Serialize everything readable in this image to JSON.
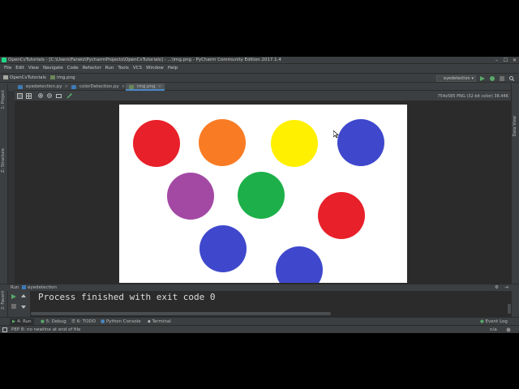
{
  "window": {
    "title": "OpenCvTutorials - [C:\\Users\\Farwiz\\PycharmProjects\\OpenCvTutorials] - ...\\img.png - PyCharm Community Edition 2017.1.4",
    "controls": [
      "–",
      "☐",
      "✕"
    ]
  },
  "menu": [
    "File",
    "Edit",
    "View",
    "Navigate",
    "Code",
    "Refactor",
    "Run",
    "Tools",
    "VCS",
    "Window",
    "Help"
  ],
  "breadcrumb": {
    "project": "OpenCvTutorials",
    "file": "img.png"
  },
  "run_config": {
    "label": "eyedetection"
  },
  "tabs": [
    {
      "label": "eyedetection.py",
      "close": "×"
    },
    {
      "label": "colorDetection.py",
      "close": "×"
    },
    {
      "label": "img.png",
      "close": "×",
      "active": true
    }
  ],
  "side_labels": {
    "project": "1: Project",
    "structure": "Z: Structure",
    "favorites": "2: Favorites",
    "database": "Data View"
  },
  "image_viewer": {
    "info": "754x585 PNG (32-bit color) 38.44K",
    "circles": [
      {
        "color": "#e8202a"
      },
      {
        "color": "#f97c25"
      },
      {
        "color": "#fff000"
      },
      {
        "color": "#3f48cc"
      },
      {
        "color": "#a349a4"
      },
      {
        "color": "#1db04a"
      },
      {
        "color": "#e8202a"
      },
      {
        "color": "#3f48cc"
      },
      {
        "color": "#3f48cc"
      }
    ]
  },
  "run_panel": {
    "tab_label": "Run",
    "config": "eyedetection",
    "output": "Process finished with exit code 0"
  },
  "tool_windows": [
    "4: Run",
    "5: Debug",
    "6: TODO",
    "Python Console",
    "Terminal"
  ],
  "status": {
    "message": "PEP 8: no newline at end of file",
    "event_log": "Event Log",
    "position": "n/a"
  },
  "colors": {
    "background": "#3c3f41",
    "editor": "#2b2b2b",
    "accent": "#4a88c7",
    "run_green": "#59a869"
  }
}
